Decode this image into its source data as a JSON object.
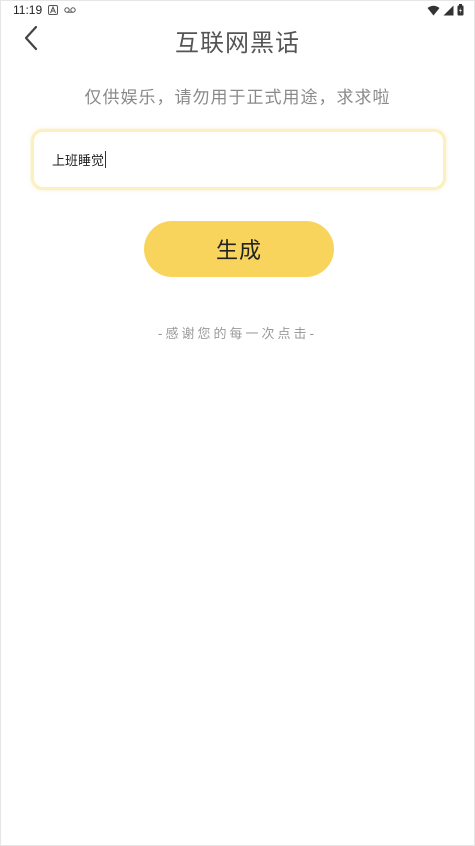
{
  "status_bar": {
    "time": "11:19",
    "icons": [
      "a-notification-icon",
      "voicemail-icon",
      "wifi-icon",
      "signal-icon",
      "battery-icon"
    ]
  },
  "header": {
    "title": "互联网黑话",
    "back_icon": "chevron-left-icon"
  },
  "subtitle": "仅供娱乐，请勿用于正式用途，求求啦",
  "input": {
    "value": "上班睡觉"
  },
  "generate_button": {
    "label": "生成",
    "color": "#f8d45c"
  },
  "footer_note": "-感谢您的每一次点击-"
}
